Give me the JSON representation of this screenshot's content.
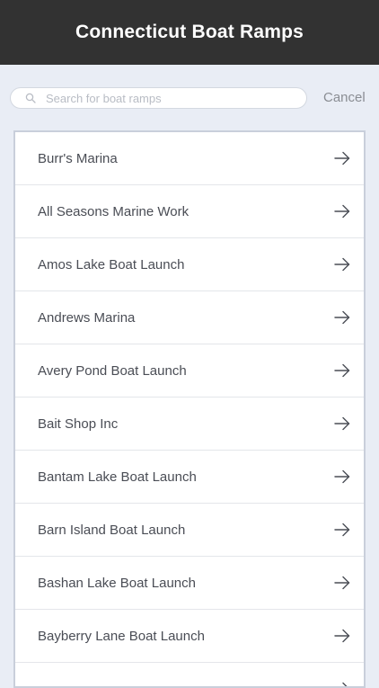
{
  "header": {
    "title": "Connecticut Boat Ramps"
  },
  "search": {
    "placeholder": "Search for boat ramps",
    "value": "",
    "cancel_label": "Cancel",
    "icon": "search-icon"
  },
  "ramps": [
    {
      "label": "Burr's Marina",
      "icon": "arrow-right-icon"
    },
    {
      "label": "All Seasons Marine Work",
      "icon": "arrow-right-icon"
    },
    {
      "label": "Amos Lake Boat Launch",
      "icon": "arrow-right-icon"
    },
    {
      "label": "Andrews Marina",
      "icon": "arrow-right-icon"
    },
    {
      "label": "Avery Pond Boat Launch",
      "icon": "arrow-right-icon"
    },
    {
      "label": "Bait Shop Inc",
      "icon": "arrow-right-icon"
    },
    {
      "label": "Bantam Lake Boat Launch",
      "icon": "arrow-right-icon"
    },
    {
      "label": "Barn Island Boat Launch",
      "icon": "arrow-right-icon"
    },
    {
      "label": "Bashan Lake Boat Launch",
      "icon": "arrow-right-icon"
    },
    {
      "label": "Bayberry Lane Boat Launch",
      "icon": "arrow-right-icon"
    },
    {
      "label": "",
      "icon": "arrow-right-icon"
    }
  ],
  "colors": {
    "nav_background": "#323232",
    "page_background": "#e9edf5",
    "text": "#4a4d55",
    "cancel_text": "#8a8d93"
  }
}
